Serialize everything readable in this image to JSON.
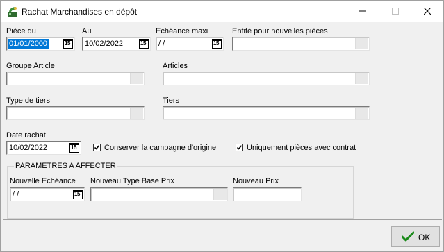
{
  "window": {
    "title": "Rachat Marchandises en dépôt"
  },
  "form": {
    "piece_du": {
      "label": "Pièce du",
      "value": "01/01/2000"
    },
    "au": {
      "label": "Au",
      "value": "10/02/2022"
    },
    "echeance_maxi": {
      "label": "Echéance maxi",
      "value": " /  /"
    },
    "entite": {
      "label": "Entité pour nouvelles pièces",
      "value": ""
    },
    "groupe_article": {
      "label": "Groupe Article",
      "value": ""
    },
    "articles": {
      "label": "Articles",
      "value": ""
    },
    "type_tiers": {
      "label": "Type de tiers",
      "value": ""
    },
    "tiers": {
      "label": "Tiers",
      "value": ""
    },
    "date_rachat": {
      "label": "Date rachat",
      "value": "10/02/2022"
    },
    "conserver": {
      "label": "Conserver la campagne d'origine",
      "checked": true
    },
    "uniquement": {
      "label": "Uniquement pièces avec contrat",
      "checked": true
    }
  },
  "params": {
    "title": "PARAMETRES A AFFECTER",
    "nouvelle_echeance": {
      "label": "Nouvelle Echéance",
      "value": " /  /"
    },
    "type_base_prix": {
      "label": "Nouveau Type Base Prix",
      "value": ""
    },
    "nouveau_prix": {
      "label": "Nouveau Prix",
      "value": ""
    }
  },
  "calendar_icon_text": "15",
  "footer": {
    "ok_label": "OK"
  }
}
